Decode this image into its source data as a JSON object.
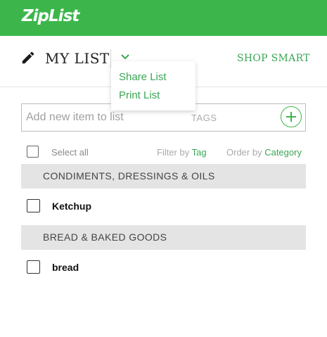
{
  "app": {
    "logo_text": "ZipList",
    "brand_color": "#3cb64b",
    "accent_color": "#3aa655"
  },
  "header": {
    "edit_icon": "pencil-icon",
    "list_title": "MY LIST",
    "dropdown_icon": "chevron-down-icon",
    "shop_smart_label": "SHOP SMART"
  },
  "dropdown_menu": {
    "items": [
      "Share List",
      "Print List"
    ]
  },
  "add_item": {
    "placeholder": "Add new item to list",
    "value": "",
    "tags_label": "TAGS",
    "add_icon": "plus-circle-icon"
  },
  "toolbar": {
    "select_all_label": "Select all",
    "filter_prefix": "Filter by",
    "filter_value": "Tag",
    "order_prefix": "Order by",
    "order_value": "Category"
  },
  "categories": [
    {
      "name": "CONDIMENTS, DRESSINGS & OILS",
      "items": [
        {
          "name": "Ketchup",
          "checked": false
        }
      ]
    },
    {
      "name": "BREAD & BAKED GOODS",
      "items": [
        {
          "name": "bread",
          "checked": false
        }
      ]
    }
  ]
}
